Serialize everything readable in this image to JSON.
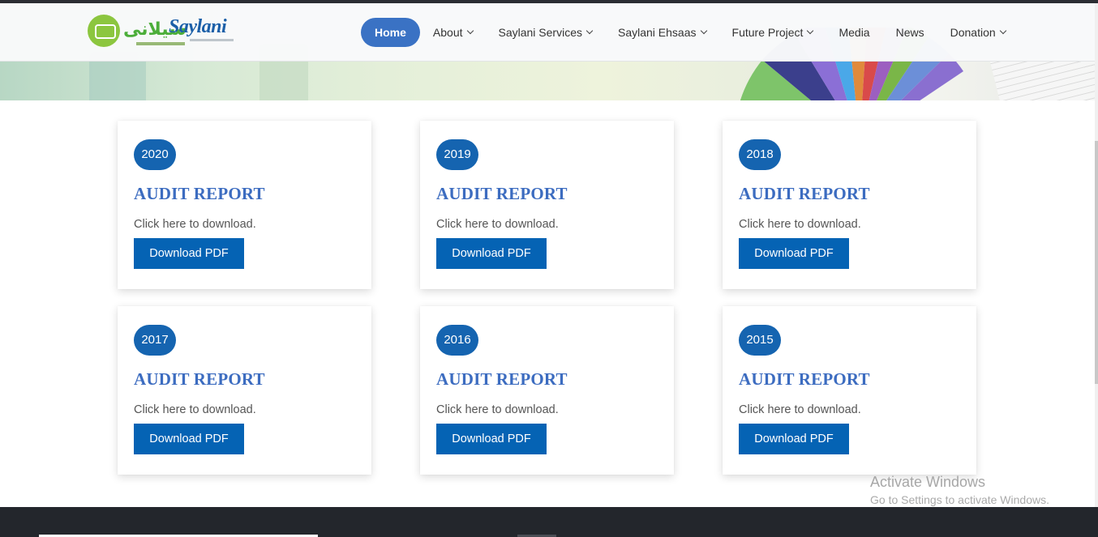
{
  "brand": {
    "name": "Saylani",
    "urdu_name": "سیلانی"
  },
  "nav": {
    "items": [
      {
        "label": "Home",
        "active": true,
        "dropdown": false
      },
      {
        "label": "About",
        "active": false,
        "dropdown": true
      },
      {
        "label": "Saylani Services",
        "active": false,
        "dropdown": true
      },
      {
        "label": "Saylani Ehsaas",
        "active": false,
        "dropdown": true
      },
      {
        "label": "Future Project",
        "active": false,
        "dropdown": true
      },
      {
        "label": "Media",
        "active": false,
        "dropdown": false
      },
      {
        "label": "News",
        "active": false,
        "dropdown": false
      },
      {
        "label": "Donation",
        "active": false,
        "dropdown": true
      }
    ]
  },
  "reports": [
    {
      "year": "2020",
      "title": "AUDIT REPORT",
      "text": "Click here to download.",
      "button": "Download PDF"
    },
    {
      "year": "2019",
      "title": "AUDIT REPORT",
      "text": "Click here to download.",
      "button": "Download PDF"
    },
    {
      "year": "2018",
      "title": "AUDIT REPORT",
      "text": "Click here to download.",
      "button": "Download PDF"
    },
    {
      "year": "2017",
      "title": "AUDIT REPORT",
      "text": "Click here to download.",
      "button": "Download PDF"
    },
    {
      "year": "2016",
      "title": "AUDIT REPORT",
      "text": "Click here to download.",
      "button": "Download PDF"
    },
    {
      "year": "2015",
      "title": "AUDIT REPORT",
      "text": "Click here to download.",
      "button": "Download PDF"
    }
  ],
  "watermark": {
    "line1": "Activate Windows",
    "line2": "Go to Settings to activate Windows."
  },
  "colors": {
    "primary": "#0563b4",
    "nav_active": "#3a72c4",
    "title": "#3c6cc0",
    "footer": "#23262c",
    "logo_green": "#8cc63f"
  }
}
